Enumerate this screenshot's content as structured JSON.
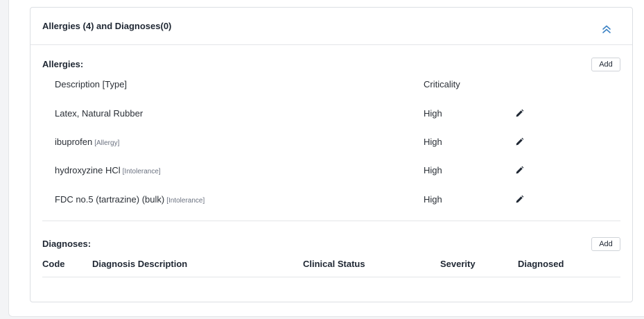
{
  "panel": {
    "title": "Allergies (4) and Diagnoses(0)"
  },
  "allergies": {
    "title": "Allergies:",
    "add_label": "Add",
    "columns": {
      "description": "Description [Type]",
      "criticality": "Criticality"
    },
    "rows": [
      {
        "description": "Latex, Natural Rubber",
        "type": "",
        "criticality": "High"
      },
      {
        "description": "ibuprofen",
        "type": "[Allergy]",
        "criticality": "High"
      },
      {
        "description": "hydroxyzine HCl",
        "type": "[Intolerance]",
        "criticality": "High"
      },
      {
        "description": "FDC no.5 (tartrazine) (bulk)",
        "type": "[Intolerance]",
        "criticality": "High"
      }
    ]
  },
  "diagnoses": {
    "title": "Diagnoses:",
    "add_label": "Add",
    "columns": {
      "code": "Code",
      "description": "Diagnosis Description",
      "clinical_status": "Clinical Status",
      "severity": "Severity",
      "diagnosed": "Diagnosed"
    }
  },
  "colors": {
    "accent": "#3b82c4",
    "text": "#1f2733",
    "border": "#dcdfe3"
  },
  "icons": {
    "collapse": "chevrons-up-icon",
    "edit": "pencil-icon"
  }
}
